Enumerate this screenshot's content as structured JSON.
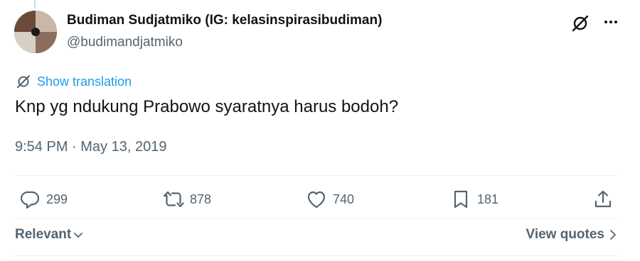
{
  "author": {
    "name": "Budiman Sudjatmiko (IG: kelasinspirasibudiman)",
    "handle": "@budimandjatmiko",
    "avatar_icon": "collage-avatar"
  },
  "header_actions": {
    "grok_icon": "grok-icon",
    "more_icon": "more-dots-icon"
  },
  "translation": {
    "label": "Show translation",
    "icon": "grok-icon"
  },
  "tweet": {
    "text": "Knp yg ndukung Prabowo syaratnya harus bodoh?",
    "timestamp": "9:54 PM · May 13, 2019"
  },
  "actions": {
    "replies": "299",
    "reposts": "878",
    "likes": "740",
    "bookmarks": "181"
  },
  "footer": {
    "sort_label": "Relevant",
    "view_quotes_label": "View quotes"
  },
  "colors": {
    "accent": "#1d9bf0",
    "text": "#0f1419",
    "secondary": "#536471"
  }
}
